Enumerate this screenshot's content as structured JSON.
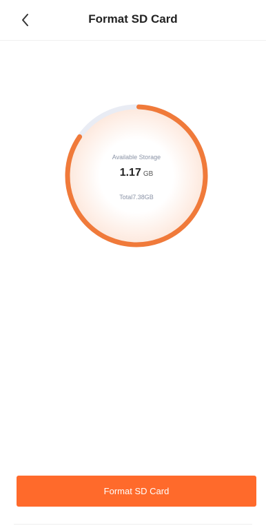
{
  "header": {
    "title": "Format SD Card",
    "back_icon": "chevron-left-icon"
  },
  "storage": {
    "available_label": "Available Storage",
    "available_value": "1.17",
    "available_unit": "GB",
    "total_label": "Total7.38GB",
    "used_fraction": 0.84,
    "colors": {
      "track": "#e9ecf4",
      "progress": "#f07a3a",
      "inner_glow": "#fdeee6"
    }
  },
  "actions": {
    "format_label": "Format SD Card",
    "accent": "#ff6a2b"
  }
}
